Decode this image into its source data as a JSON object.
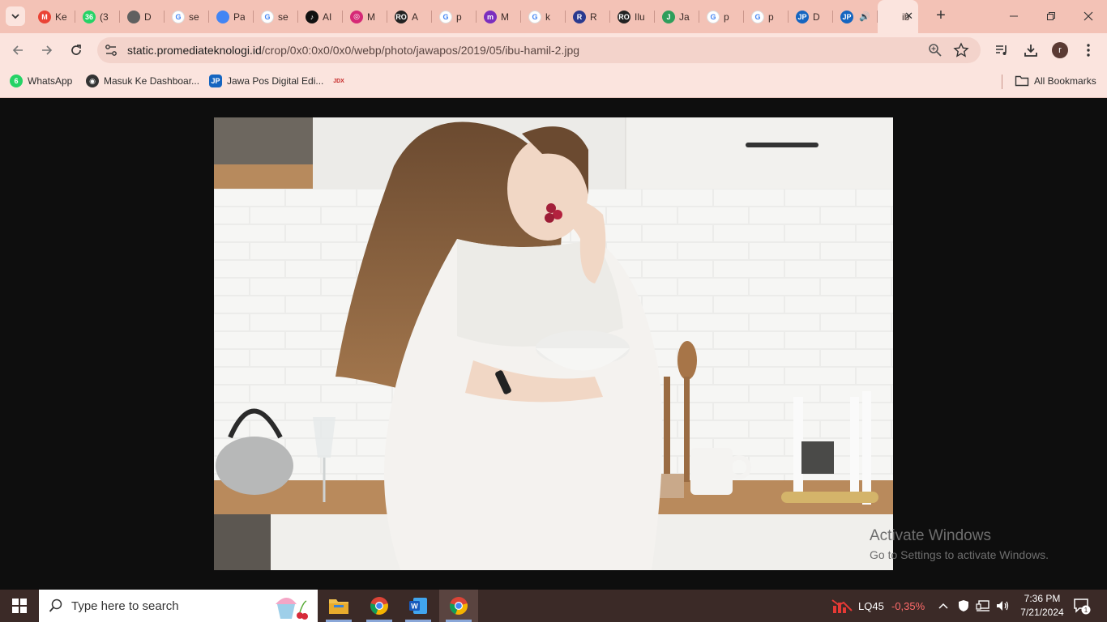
{
  "browser": {
    "tabs": [
      {
        "title": "Ke",
        "icon": "gmail-icon",
        "color": "#ea4335",
        "glyph": "M"
      },
      {
        "title": "(3",
        "icon": "whatsapp-icon",
        "color": "#25d366",
        "glyph": "36"
      },
      {
        "title": "D",
        "icon": "site-icon",
        "color": "#606060",
        "glyph": ""
      },
      {
        "title": "se",
        "icon": "google-icon",
        "color": "#ffffff",
        "glyph": "G"
      },
      {
        "title": "Pa",
        "icon": "docs-icon",
        "color": "#4285f4",
        "glyph": ""
      },
      {
        "title": "se",
        "icon": "google-icon",
        "color": "#ffffff",
        "glyph": "G"
      },
      {
        "title": "AI",
        "icon": "tiktok-icon",
        "color": "#111111",
        "glyph": "♪"
      },
      {
        "title": "M",
        "icon": "instagram-icon",
        "color": "#d62976",
        "glyph": "◎"
      },
      {
        "title": "A",
        "icon": "site-icon",
        "color": "#222222",
        "glyph": "RO"
      },
      {
        "title": "p",
        "icon": "google-icon",
        "color": "#ffffff",
        "glyph": "G"
      },
      {
        "title": "M",
        "icon": "site-icon",
        "color": "#7b2fbe",
        "glyph": "m"
      },
      {
        "title": "k",
        "icon": "google-icon",
        "color": "#ffffff",
        "glyph": "G"
      },
      {
        "title": "R",
        "icon": "site-icon",
        "color": "#2a3a8f",
        "glyph": "R"
      },
      {
        "title": "Ilu",
        "icon": "site-icon",
        "color": "#222222",
        "glyph": "RO"
      },
      {
        "title": "Ja",
        "icon": "site-icon",
        "color": "#2e9e5b",
        "glyph": "J"
      },
      {
        "title": "p",
        "icon": "google-icon",
        "color": "#ffffff",
        "glyph": "G"
      },
      {
        "title": "p",
        "icon": "google-icon",
        "color": "#ffffff",
        "glyph": "G"
      },
      {
        "title": "D",
        "icon": "jawapos-icon",
        "color": "#1565c0",
        "glyph": "JP"
      },
      {
        "title": "",
        "icon": "jawapos-icon",
        "color": "#1565c0",
        "glyph": "JP",
        "audio": true
      },
      {
        "title": "ib",
        "icon": "page-icon",
        "color": "#fbe4de",
        "glyph": "",
        "active": true
      }
    ],
    "url_host": "static.promediateknologi.id",
    "url_path": "/crop/0x0:0x0/0x0/webp/photo/jawapos/2019/05/ibu-hamil-2.jpg",
    "profile_initial": "r",
    "bookmarks": [
      {
        "label": "WhatsApp",
        "icon": "whatsapp-icon",
        "color": "#25d366",
        "glyph": "6"
      },
      {
        "label": "Masuk Ke Dashboar...",
        "icon": "site-icon",
        "color": "#333333",
        "glyph": "◉"
      },
      {
        "label": "Jawa Pos Digital Edi...",
        "icon": "jawapos-icon",
        "color": "#1565c0",
        "glyph": "JP"
      },
      {
        "label": "",
        "icon": "jdx-icon",
        "color": "#fbe4de",
        "glyph": "JDX"
      }
    ],
    "all_bookmarks_label": "All Bookmarks"
  },
  "watermark": {
    "title": "Activate Windows",
    "subtitle": "Go to Settings to activate Windows."
  },
  "taskbar": {
    "search_placeholder": "Type here to search",
    "stock_name": "LQ45",
    "stock_change": "-0,35%",
    "stock_change_color": "#ff6b6b",
    "time": "7:36 PM",
    "date": "7/21/2024",
    "notification_count": "1"
  }
}
